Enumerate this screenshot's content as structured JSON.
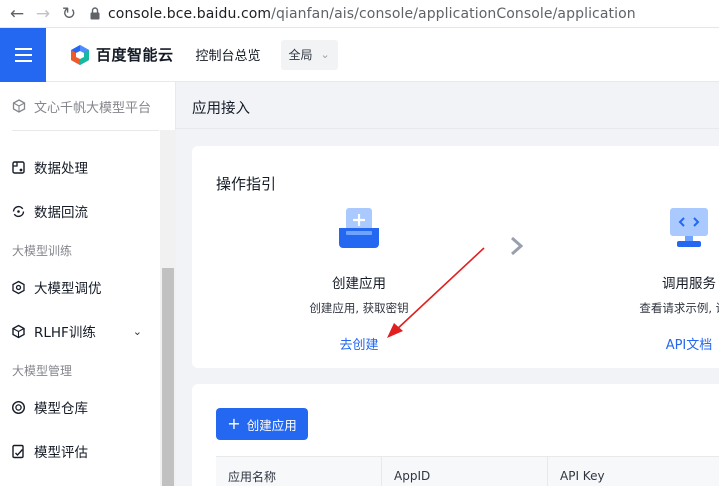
{
  "browser": {
    "url_host": "console.bce.baidu.com",
    "url_path": "/qianfan/ais/console/applicationConsole/application"
  },
  "header": {
    "brand": "百度智能云",
    "console_link": "控制台总览",
    "region": "全局"
  },
  "sidebar": {
    "platform": "文心千帆大模型平台",
    "items": [
      {
        "label": "数据处理",
        "icon": "data-process-icon"
      },
      {
        "label": "数据回流",
        "icon": "data-reflow-icon"
      }
    ],
    "groups": [
      {
        "label": "大模型训练",
        "items": [
          {
            "label": "大模型调优",
            "icon": "tuning-icon"
          },
          {
            "label": "RLHF训练",
            "icon": "rlhf-icon"
          }
        ]
      },
      {
        "label": "大模型管理",
        "items": [
          {
            "label": "模型仓库",
            "icon": "model-repo-icon"
          },
          {
            "label": "模型评估",
            "icon": "model-eval-icon"
          }
        ]
      }
    ]
  },
  "main": {
    "title": "应用接入",
    "guide": {
      "title": "操作指引",
      "steps": [
        {
          "title": "创建应用",
          "desc": "创建应用, 获取密钥",
          "link": "去创建"
        },
        {
          "title": "调用服务",
          "desc": "查看请求示例, 调用",
          "link": "API文档"
        }
      ]
    },
    "create_button": "创建应用",
    "table": {
      "columns": [
        "应用名称",
        "AppID",
        "API Key"
      ]
    }
  },
  "colors": {
    "accent": "#2468f2",
    "annotation_arrow": "#e02020"
  }
}
